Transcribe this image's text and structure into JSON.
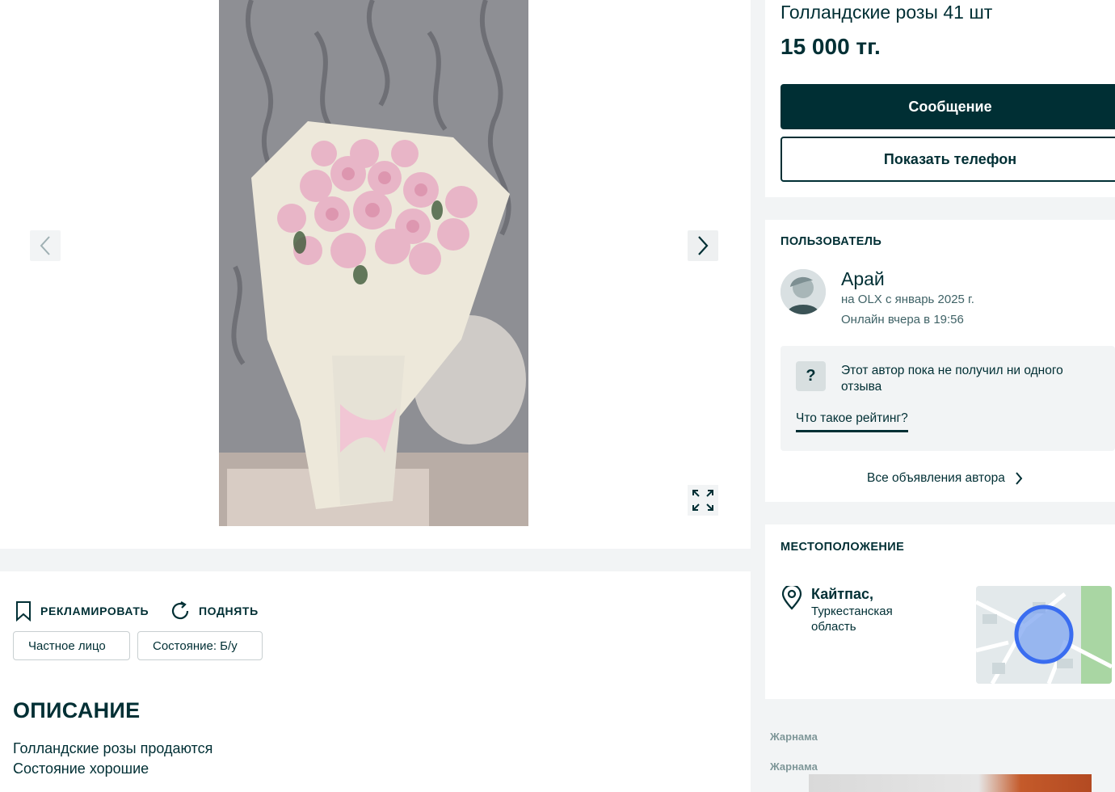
{
  "listing": {
    "title": "Голландские розы 41 шт",
    "price": "15 000 тг."
  },
  "actions": {
    "message_label": "Сообщение",
    "phone_label": "Показать телефон"
  },
  "promo": {
    "advertise_label": "РЕКЛАМИРОВАТЬ",
    "raise_label": "ПОДНЯТЬ"
  },
  "tags": [
    "Частное лицо",
    "Состояние: Б/у"
  ],
  "description": {
    "title": "ОПИСАНИЕ",
    "lines": [
      "Голландские розы продаются",
      "Состояние хорошие"
    ]
  },
  "user": {
    "section_title": "ПОЛЬЗОВАТЕЛЬ",
    "name": "Арай",
    "since": "на OLX с январь 2025 г.",
    "online": "Онлайн вчера в 19:56",
    "rating_badge": "?",
    "rating_text": "Этот автор пока не получил ни одного отзыва",
    "rating_link": "Что такое рейтинг?",
    "all_ads_label": "Все объявления автора"
  },
  "location": {
    "section_title": "МЕСТОПОЛОЖЕНИЕ",
    "city": "Кайтпас,",
    "region": "Туркестанская область"
  },
  "ads": {
    "label_1": "Жарнама",
    "label_2": "Жарнама"
  },
  "icons": {
    "prev": "chevron-left-icon",
    "next": "chevron-right-icon",
    "expand": "expand-icon",
    "advertise": "bookmark-icon",
    "raise": "refresh-icon",
    "pin": "location-pin-icon",
    "all_ads": "chevron-right-icon"
  },
  "colors": {
    "primary": "#002f34",
    "background": "#f2f4f5",
    "map_marker": "#3a6df0"
  }
}
